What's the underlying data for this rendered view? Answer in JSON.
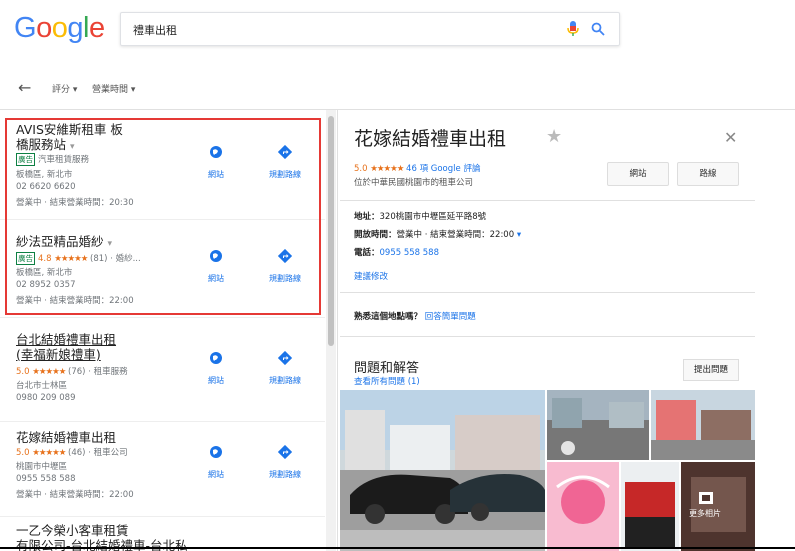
{
  "search": {
    "logo_letters": [
      "G",
      "o",
      "o",
      "g",
      "l",
      "e"
    ],
    "logo_colors": [
      "#4285F4",
      "#EA4335",
      "#FBBC05",
      "#4285F4",
      "#34A853",
      "#EA4335"
    ],
    "query": "禮車出租",
    "mic_icon": "mic-icon",
    "search_icon": "search-icon"
  },
  "filters": {
    "back_icon": "arrow-left-icon",
    "rating_label": "評分",
    "hours_label": "營業時間",
    "chevron": "▾"
  },
  "results": [
    {
      "name_line1": "AVIS安維斯租車 板",
      "name_line2": "橋服務站",
      "name_suffix": "▾",
      "ad": "廣告",
      "category": "汽車租賃服務",
      "address": "板橋區, 新北市",
      "phone": "02 6620 6620",
      "hours": "營業中 · 結束營業時間：20:30",
      "website": "網站",
      "directions": "規劃路線"
    },
    {
      "name_line1": "紗法亞精品婚紗",
      "name_suffix": "▾",
      "ad": "廣告",
      "rating": "4.8",
      "stars": "★★★★★",
      "reviews": "(81) · 婚紗...",
      "address": "板橋區, 新北市",
      "phone": "02 8952 0357",
      "hours": "營業中 · 結束營業時間：22:00",
      "website": "網站",
      "directions": "規劃路線"
    },
    {
      "name_line1": "台北結婚禮車出租",
      "name_line2": "(幸福新娘禮車)",
      "rating": "5.0",
      "stars": "★★★★★",
      "reviews": "(76) · 租車服務",
      "address": "台北市士林區",
      "phone": "0980 209 089",
      "website": "網站",
      "directions": "規劃路線"
    },
    {
      "name_line1": "花嫁結婚禮車出租",
      "rating": "5.0",
      "stars": "★★★★★",
      "reviews": "(46) · 租車公司",
      "address": "桃園市中壢區",
      "phone": "0955 558 588",
      "hours": "營業中 · 結束營業時間：22:00",
      "website": "網站",
      "directions": "規劃路線"
    },
    {
      "name_line1": "一乙今榮小客車租賃",
      "name_line2": "有限公司-台北結婚禮車-台北私"
    }
  ],
  "detail": {
    "title": "花嫁結婚禮車出租",
    "star_icon": "★",
    "close_icon": "✕",
    "rating": "5.0",
    "stars": "★★★★★",
    "reviews": "46 項 Google 評論",
    "type": "位於中華民國桃園市的租車公司",
    "website_btn": "網站",
    "directions_btn": "路線",
    "address_label": "地址：",
    "address": "320桃園市中壢區延平路8號",
    "hours_label": "開放時間：",
    "hours": "營業中 · 結束營業時間：22:00",
    "hours_chevron": "▾",
    "phone_label": "電話：",
    "phone": "0955 558 588",
    "suggest_edit": "建議修改",
    "know_place": "熟悉這個地點嗎？",
    "answer_link": "回答簡單問題",
    "qa_title": "問題和解答",
    "qa_link": "查看所有問題 (1)",
    "ask_btn": "提出問題",
    "more_photos": "更多相片"
  },
  "colors": {
    "accent_blue": "#1a73e8",
    "star_orange": "#e7711b",
    "ad_green": "#0d8043",
    "highlight_red": "#e53935"
  }
}
